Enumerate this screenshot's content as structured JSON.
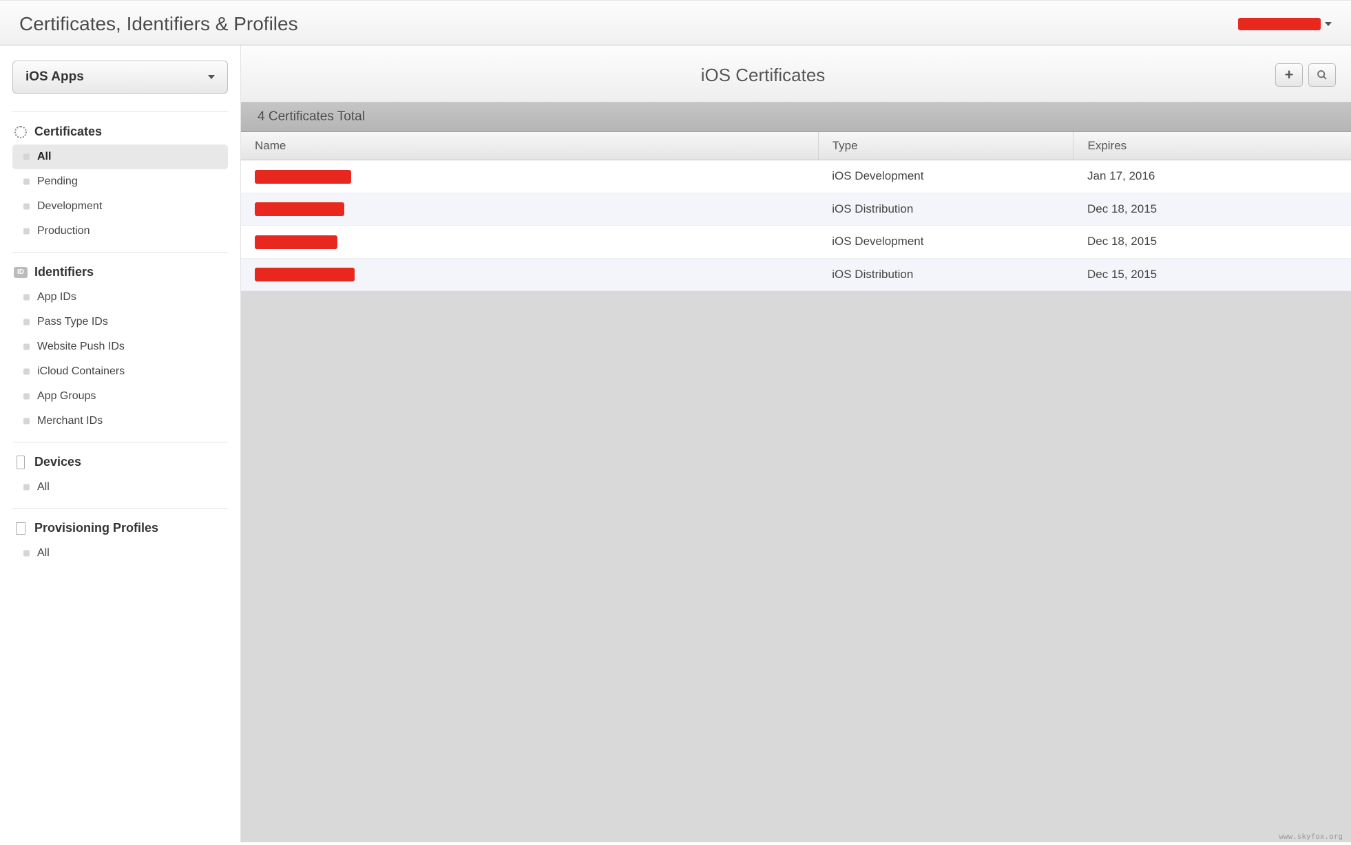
{
  "header": {
    "title": "Certificates, Identifiers & Profiles"
  },
  "sidebar": {
    "picker_label": "iOS Apps",
    "sections": [
      {
        "title": "Certificates",
        "icon": "gear",
        "items": [
          {
            "label": "All",
            "active": true
          },
          {
            "label": "Pending",
            "active": false
          },
          {
            "label": "Development",
            "active": false
          },
          {
            "label": "Production",
            "active": false
          }
        ]
      },
      {
        "title": "Identifiers",
        "icon": "id",
        "items": [
          {
            "label": "App IDs",
            "active": false
          },
          {
            "label": "Pass Type IDs",
            "active": false
          },
          {
            "label": "Website Push IDs",
            "active": false
          },
          {
            "label": "iCloud Containers",
            "active": false
          },
          {
            "label": "App Groups",
            "active": false
          },
          {
            "label": "Merchant IDs",
            "active": false
          }
        ]
      },
      {
        "title": "Devices",
        "icon": "device",
        "items": [
          {
            "label": "All",
            "active": false
          }
        ]
      },
      {
        "title": "Provisioning Profiles",
        "icon": "doc",
        "items": [
          {
            "label": "All",
            "active": false
          }
        ]
      }
    ]
  },
  "main": {
    "title": "iOS Certificates",
    "count_text": "4 Certificates Total",
    "columns": {
      "name": "Name",
      "type": "Type",
      "expires": "Expires"
    },
    "rows": [
      {
        "name_redacted_width": 140,
        "type": "iOS Development",
        "expires": "Jan 17, 2016"
      },
      {
        "name_redacted_width": 130,
        "type": "iOS Distribution",
        "expires": "Dec 18, 2015"
      },
      {
        "name_redacted_width": 120,
        "type": "iOS Development",
        "expires": "Dec 18, 2015"
      },
      {
        "name_redacted_width": 145,
        "type": "iOS Distribution",
        "expires": "Dec 15, 2015"
      }
    ]
  },
  "footer": {
    "watermark": "www.skyfox.org"
  }
}
